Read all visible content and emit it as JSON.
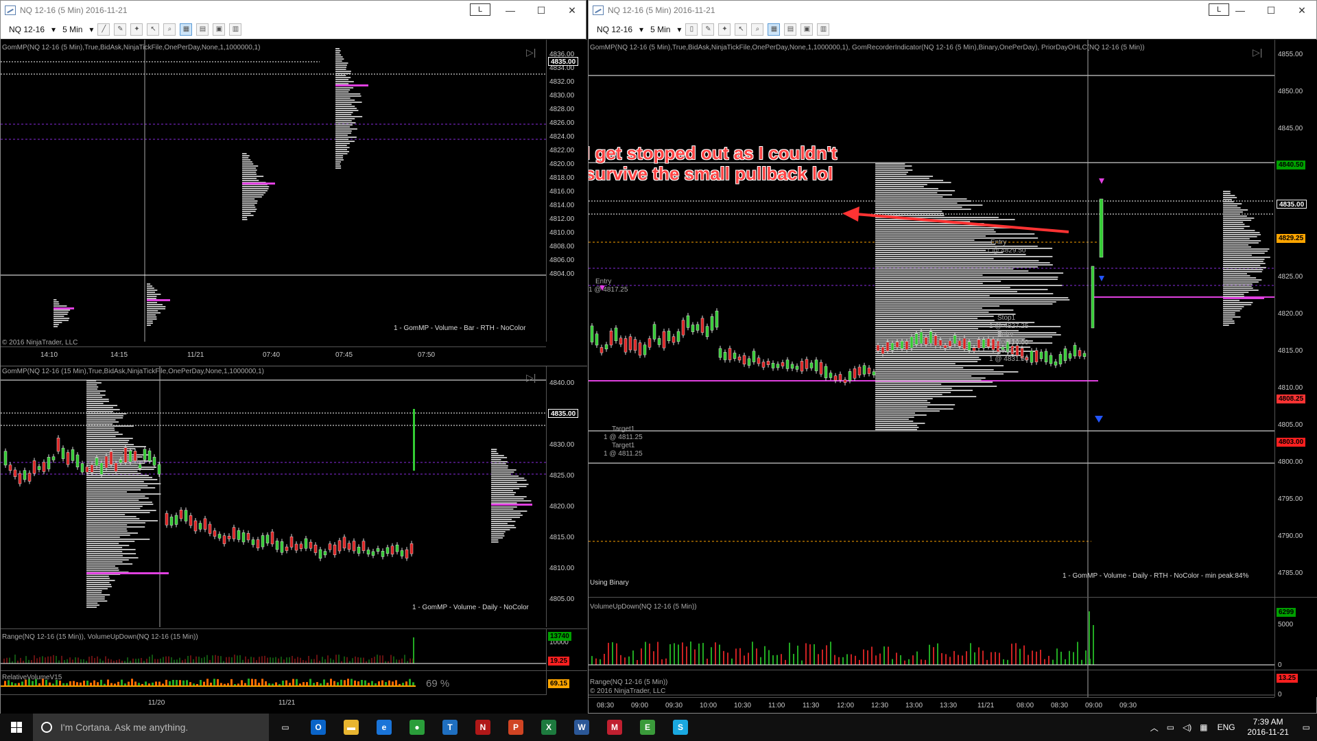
{
  "windows": {
    "left": {
      "title": "NQ 12-16 (5 Min)  2016-11-21",
      "instrument": "NQ 12-16",
      "interval": "5 Min",
      "lbox": "L",
      "top_panel": {
        "indicator": "GomMP(NQ 12-16 (5 Min),True,BidAsk,NinjaTickFile,OnePerDay,None,1,1000000,1)",
        "footer": "1 - GomMP  - Volume - Bar - RTH - NoColor",
        "copyright": "© 2016 NinjaTrader, LLC",
        "price_ticks": [
          "4836.00",
          "4834.00",
          "4832.00",
          "4830.00",
          "4828.00",
          "4826.00",
          "4824.00",
          "4822.00",
          "4820.00",
          "4818.00",
          "4816.00",
          "4814.00",
          "4812.00",
          "4810.00",
          "4808.00",
          "4806.00",
          "4804.00"
        ],
        "current_price": "4835.00",
        "time_ticks": [
          "14:10",
          "14:15",
          "11/21",
          "07:40",
          "07:45",
          "07:50"
        ]
      },
      "bottom_panel": {
        "indicator": "GomMP(NQ 12-16 (15 Min),True,BidAsk,NinjaTickFile,OnePerDay,None,1,1000000,1)",
        "footer": "1 - GomMP - Volume - Daily - NoColor",
        "price_ticks": [
          "4840.00",
          "4835.00",
          "4830.00",
          "4825.00",
          "4820.00",
          "4815.00",
          "4810.00",
          "4805.00"
        ],
        "current_price": "4835.00",
        "vol_label": "Range(NQ 12-16 (15 Min)), VolumeUpDown(NQ 12-16 (15 Min))",
        "vol_ticks": [
          "10000"
        ],
        "vol_box1": "13740",
        "vol_box2": "19.25",
        "rel_label": "RelativeVolumeV15",
        "rel_pct": "69 %",
        "rel_box": "69.15",
        "time_ticks": [
          "11/20",
          "11/21"
        ]
      }
    },
    "right": {
      "title": "NQ 12-16 (5 Min)  2016-11-21",
      "instrument": "NQ 12-16",
      "interval": "5 Min",
      "lbox": "L",
      "main_panel": {
        "indicator": "GomMP(NQ 12-16 (5 Min),True,BidAsk,NinjaTickFile,OnePerDay,None,1,1000000,1), GomRecorderIndicator(NQ 12-16 (5 Min),Binary,OnePerDay), PriorDayOHLC(NQ 12-16 (5 Min))",
        "using_binary": "Using Binary",
        "footer": "1 - GomMP  - Volume - Daily - RTH - NoColor - min peak:84%",
        "price_ticks": [
          "4855.00",
          "4850.00",
          "4845.00",
          "4840.00",
          "4835.00",
          "4830.00",
          "4825.00",
          "4820.00",
          "4815.00",
          "4810.00",
          "4805.00",
          "4800.00",
          "4795.00",
          "4790.00",
          "4785.00"
        ],
        "price_boxes": [
          {
            "label": "4840.50",
            "bg": "#00a000",
            "fg": "#000000"
          },
          {
            "label": "4835.00",
            "bg": "#000000",
            "fg": "#ffffff"
          },
          {
            "label": "4829.25",
            "bg": "#ffa500",
            "fg": "#000000"
          },
          {
            "label": "4808.25",
            "bg": "#ff3333",
            "fg": "#000000"
          },
          {
            "label": "4803.00",
            "bg": "#ff2020",
            "fg": "#000000"
          }
        ],
        "trade_labels": {
          "entry1": "Entry",
          "entry1_fill": "1 @ 4817.25",
          "target1": "Target1",
          "target1_fill": "1 @ 4811.25",
          "target2": "Target1",
          "target2_fill": "1 @ 4811.25",
          "entry2": "Entry",
          "entry2_fill": "1 @ 4829.50",
          "stop1": "Stop1",
          "stop1_fill": "1 @ 4827.25",
          "entry3": "Entry",
          "entry3_fill": "1 @ 4836.00",
          "stop2": "Stop1",
          "stop2_fill": "1 @ 4831.50"
        },
        "annotation": [
          "I get stopped out as I couldn't",
          "survive the small pullback lol"
        ]
      },
      "vol_panel": {
        "label": "VolumeUpDown(NQ 12-16 (5 Min))",
        "ticks": [
          "5000",
          "0"
        ],
        "box": "6299"
      },
      "range_panel": {
        "label": "Range(NQ 12-16 (5 Min))",
        "copyright": "© 2016 NinjaTrader, LLC",
        "ticks": [
          "0"
        ],
        "box": "13.25"
      },
      "time_ticks": [
        "08:30",
        "09:00",
        "09:30",
        "10:00",
        "10:30",
        "11:00",
        "11:30",
        "12:00",
        "12:30",
        "13:00",
        "13:30",
        "11/21",
        "08:00",
        "08:30",
        "09:00",
        "09:30"
      ]
    }
  },
  "taskbar": {
    "search_placeholder": "I'm Cortana. Ask me anything.",
    "apps": [
      {
        "name": "task-view",
        "glyph": "▭",
        "color": "#101010"
      },
      {
        "name": "outlook",
        "glyph": "O",
        "color": "#0a64c8"
      },
      {
        "name": "file-explorer",
        "glyph": "▬",
        "color": "#e8b530"
      },
      {
        "name": "edge",
        "glyph": "e",
        "color": "#1a74d8"
      },
      {
        "name": "chrome",
        "glyph": "●",
        "color": "#2a9d3a"
      },
      {
        "name": "tws",
        "glyph": "T",
        "color": "#1f6fc0"
      },
      {
        "name": "ninjatrader",
        "glyph": "N",
        "color": "#b01818"
      },
      {
        "name": "powerpoint",
        "glyph": "P",
        "color": "#d04423"
      },
      {
        "name": "excel",
        "glyph": "X",
        "color": "#1d7a3e"
      },
      {
        "name": "word",
        "glyph": "W",
        "color": "#2b5797"
      },
      {
        "name": "red-app",
        "glyph": "M",
        "color": "#c02030"
      },
      {
        "name": "evernote",
        "glyph": "E",
        "color": "#3a9a3a"
      },
      {
        "name": "skype",
        "glyph": "S",
        "color": "#1aa8e0"
      }
    ],
    "language": "ENG",
    "time": "7:39 AM",
    "date": "2016-11-21"
  }
}
